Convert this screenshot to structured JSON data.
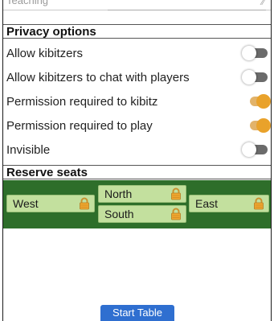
{
  "top": {
    "partial_label": "Teaching"
  },
  "privacy": {
    "header": "Privacy options",
    "options": [
      {
        "label": "Allow kibitzers",
        "state": "off"
      },
      {
        "label": "Allow kibitzers to chat with players",
        "state": "off"
      },
      {
        "label": "Permission required to kibitz",
        "state": "on"
      },
      {
        "label": "Permission required to play",
        "state": "on"
      },
      {
        "label": "Invisible",
        "state": "off"
      }
    ]
  },
  "reserve": {
    "header": "Reserve seats",
    "seats": [
      "West",
      "North",
      "South",
      "East"
    ],
    "lock_icon": "padlock-icon"
  },
  "actions": {
    "start_label": "Start Table"
  },
  "colors": {
    "table_green": "#2e6e2a",
    "seat_fill": "#c3e09e",
    "toggle_on": "#e9a22b",
    "toggle_off": "#6b6b6b",
    "button_blue": "#2f6fd0"
  }
}
